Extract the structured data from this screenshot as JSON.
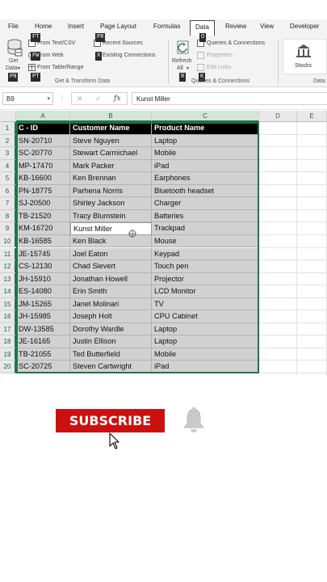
{
  "ribbon_tabs": [
    "File",
    "Home",
    "Insert",
    "Page Layout",
    "Formulas",
    "Data",
    "Review",
    "View",
    "Developer"
  ],
  "active_tab": "Data",
  "get_data": {
    "label_line1": "Get",
    "label_line2": "Data",
    "from_text_csv": "From Text/CSV",
    "from_web": "From Web",
    "from_table_range": "From Table/Range",
    "recent_sources": "Recent Sources",
    "existing_connections": "Existing Connections",
    "group_name": "Get & Transform Data"
  },
  "queries": {
    "refresh_line1": "Refresh",
    "refresh_line2": "All",
    "queries_connections": "Queries & Connections",
    "properties": "Properties",
    "edit_links": "Edit Links",
    "group_name": "Queries & Connections"
  },
  "data_types": {
    "stocks": "Stocks",
    "group_name": "Data"
  },
  "keytips": {
    "get_data": "PN",
    "from_text": "FT",
    "from_web": "FW",
    "from_table": "PT",
    "recent": "PR",
    "existing": "X",
    "queries": "O",
    "refresh": "R",
    "edit_links": "K"
  },
  "formula_bar": {
    "name_box": "B9",
    "formula": "Kunst Miller",
    "cancel_symbol": "✕",
    "enter_symbol": "✓",
    "fx_symbol": "fx"
  },
  "columns": [
    "A",
    "B",
    "C",
    "D",
    "E"
  ],
  "table": {
    "headers": [
      "C - ID",
      "Customer Name",
      "Product Name"
    ],
    "rows": [
      [
        "SN-20710",
        "Steve Nguyen",
        "Laptop"
      ],
      [
        "SC-20770",
        "Stewart Carmichael",
        "Mobile"
      ],
      [
        "MP-17470",
        "Mark Packer",
        "iPad"
      ],
      [
        "KB-16600",
        "Ken Brennan",
        "Earphones"
      ],
      [
        "PN-18775",
        "Parhena Norris",
        "Bluetooth headset"
      ],
      [
        "SJ-20500",
        "Shirley Jackson",
        "Charger"
      ],
      [
        "TB-21520",
        "Tracy Blumstein",
        "Batteries"
      ],
      [
        "KM-16720",
        "Kunst Miller",
        "Trackpad"
      ],
      [
        "KB-16585",
        "Ken Black",
        "Mouse"
      ],
      [
        "JE-15745",
        "Joel Eaton",
        "Keypad"
      ],
      [
        "CS-12130",
        "Chad Sievert",
        "Touch pen"
      ],
      [
        "JH-15910",
        "Jonathan Howell",
        "Projector"
      ],
      [
        "ES-14080",
        "Erin Smith",
        "LCD Monitor"
      ],
      [
        "JM-15265",
        "Janet Molinari",
        "TV"
      ],
      [
        "JH-15985",
        "Joseph Holt",
        "CPU Cabinet"
      ],
      [
        "DW-13585",
        "Dorothy Wardle",
        "Laptop"
      ],
      [
        "JE-16165",
        "Justin Ellison",
        "Laptop"
      ],
      [
        "TB-21055",
        "Ted Butterfield",
        "Mobile"
      ],
      [
        "SC-20725",
        "Steven Cartwright",
        "iPad"
      ]
    ]
  },
  "row_numbers": [
    "1",
    "2",
    "3",
    "4",
    "5",
    "6",
    "7",
    "8",
    "9",
    "10",
    "11",
    "12",
    "13",
    "14",
    "15",
    "16",
    "17",
    "18",
    "19",
    "20"
  ],
  "active_cell": {
    "row": 8,
    "col": 1
  },
  "overlay": {
    "subscribe_label": "SUBSCRIBE"
  },
  "colors": {
    "excel_green": "#217346",
    "subscribe_red": "#cc1010",
    "header_fill": "#000000",
    "selection_fill": "#d1d1d1"
  }
}
